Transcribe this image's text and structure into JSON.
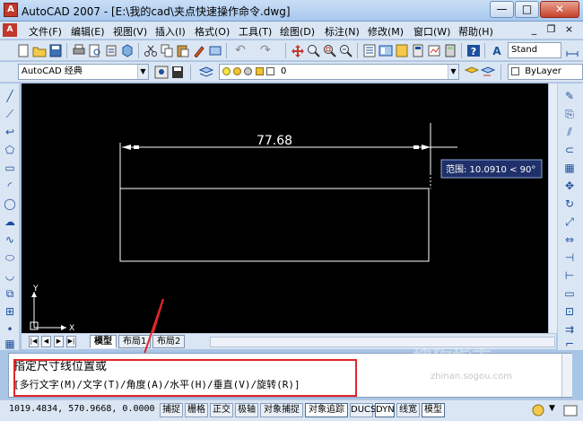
{
  "window": {
    "title": "AutoCAD 2007 - [E:\\我的cad\\夹点快速操作命令.dwg]",
    "minimize": "—",
    "maximize": "□",
    "close": "✕"
  },
  "menu": {
    "items": [
      "文件(F)",
      "编辑(E)",
      "视图(V)",
      "插入(I)",
      "格式(O)",
      "工具(T)",
      "绘图(D)",
      "标注(N)",
      "修改(M)",
      "窗口(W)",
      "帮助(H)"
    ],
    "mdi_min": "_",
    "mdi_restore": "❐",
    "mdi_close": "×"
  },
  "toolbar2": {
    "workspace": "AutoCAD 经典",
    "layer": "0",
    "color": "ByLayer"
  },
  "toolbar1": {
    "text_style": "Stand"
  },
  "canvas": {
    "dimension_value": "77.68",
    "tooltip": "范围: 10.0910 < 90°",
    "ucs_x": "X",
    "ucs_y": "Y"
  },
  "layout_tabs": [
    "模型",
    "布局1",
    "布局2"
  ],
  "command": {
    "line1": "指定尺寸线位置或",
    "line2": "[多行文字(M)/文字(T)/角度(A)/水平(H)/垂直(V)/旋转(R)]"
  },
  "status": {
    "coordinates": "1019.4834, 570.9668, 0.0000",
    "buttons": [
      {
        "label": "捕捉",
        "on": false
      },
      {
        "label": "栅格",
        "on": false
      },
      {
        "label": "正交",
        "on": false
      },
      {
        "label": "极轴",
        "on": false
      },
      {
        "label": "对象捕捉",
        "on": false
      },
      {
        "label": "对象追踪",
        "on": true
      },
      {
        "label": "DUCS",
        "on": false
      },
      {
        "label": "DYN",
        "on": true
      },
      {
        "label": "线宽",
        "on": false
      },
      {
        "label": "模型",
        "on": true
      }
    ]
  },
  "watermark": {
    "text": "搜狗指南",
    "url": "zhinan.sogou.com"
  },
  "colors": {
    "canvas_bg": "#000000",
    "highlight_box": "#e0262b",
    "tooltip_bg": "#20306a"
  }
}
